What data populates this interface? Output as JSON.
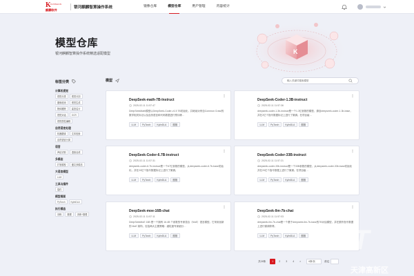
{
  "brand": {
    "logo_letter": "K",
    "logo_en": "KUNSHAN",
    "logo_cn": "麒麟软件",
    "app_title": "银河麒麟智算操作系统"
  },
  "nav": {
    "items": [
      {
        "label": "镜像仓库",
        "active": false
      },
      {
        "label": "模型仓库",
        "active": true
      },
      {
        "label": "用户管理",
        "active": false
      },
      {
        "label": "内容统计",
        "active": false
      }
    ]
  },
  "hero": {
    "title": "模型仓库",
    "subtitle": "银河麒麟智算操作系统精选适配模型"
  },
  "sidebar": {
    "header": "标签分类",
    "groups": [
      {
        "title": "计算机视觉",
        "tags": [
          "视觉分类",
          "视觉分割",
          "图像检测",
          "视觉生成",
          "物体跟踪",
          "姿态估计",
          "视觉对话",
          "OCR",
          "视觉属性编辑"
        ]
      },
      {
        "title": "自然语言处理",
        "tags": [
          "机器翻译",
          "文本检索",
          "自然语言分类"
        ]
      },
      {
        "title": "语音",
        "tags": [
          "声纹识别",
          "语音合成"
        ]
      },
      {
        "title": "多模态",
        "tags": [
          "扩散模型",
          "图文多模态"
        ]
      },
      {
        "title": "大语言模型",
        "tags": [
          "LLM"
        ]
      },
      {
        "title": "工具与插件",
        "tags": [
          "插件"
        ]
      },
      {
        "title": "模型框架",
        "tags": [
          "PyTorch",
          "KylinDLA"
        ]
      },
      {
        "title": "执行模态",
        "tags": [
          "训练",
          "推理",
          "训练+推理"
        ]
      }
    ]
  },
  "main": {
    "title": "模型",
    "search_placeholder": "输入关键词搜索模型",
    "cards": [
      {
        "title": "DeepSeek-math-7B-Instruct",
        "date": "2025-02-11 11:57:47",
        "desc": "DeepSeekMath模型以DeepSeek-Coder-v1.5 7B初始化，并继续对来自Common Crawl的数学相关标记以及自然语言和代码数据进行预训练…",
        "tags": [
          "LLM",
          "PyTorch",
          "KylinDLA",
          "图推"
        ]
      },
      {
        "title": "DeepSeek-Coder-1.3B-instruct",
        "date": "2025-02-11 11:57:36",
        "desc": "deepseek-coder-1.3b-instruct是一个1.3亿参数的模型，源自deepseek-coder-1.3b-base，并在2亿个指令数据标记上进行了微调。在项目级…",
        "tags": [
          "LLM",
          "PyTorch",
          "KylinDLA",
          "图推"
        ]
      },
      {
        "title": "DeepSeek-Coder-6.7B-instruct",
        "date": "2025-02-11 11:57:31",
        "desc": "deepseek-coder-6.7b-instruct是一个67亿参数的模型，从deepseek-coder-6.7b-base初始化，并在20亿个指令数据标记上进行了微调。",
        "tags": [
          "LLM",
          "PyTorch",
          "KylinDLA",
          "图推"
        ]
      },
      {
        "title": "DeepSeek-Coder-33B-instruct",
        "date": "2025-02-11 11:57:21",
        "desc": "deepseek-coder-33b-instruct是一个33B参数的模型，从deepseek-coder-33b-base初始化并在20亿个指令数据上进行了微调。在项目级…",
        "tags": [
          "LLM",
          "PyTorch",
          "KylinDLA",
          "图推"
        ]
      },
      {
        "title": "DeepSeek-moe-16B-chat",
        "date": "2025-02-11 11:57:11",
        "desc": "DeepSeekMoE 16B 是一个拥有 16.4B 个参数的专家混合（MoE）语言模型。它采用创新的 MoE 架构，包括两大主要策略：细粒度专家细分…",
        "tags": [
          "LLM",
          "PyTorch",
          "KylinDLA",
          "图推"
        ]
      },
      {
        "title": "DeepSeek-llm-7b-chat",
        "date": "2025-02-11 11:57:03",
        "desc": "deepseek-llm-7b-chat是一个基于deepseek-llm-7b-base的7B对话模型，并在额外指令数据上进行微调获得。",
        "tags": [
          "LLM",
          "PyTorch",
          "KylinDLA",
          "图推"
        ]
      }
    ]
  },
  "pager": {
    "total": "共28条",
    "pages": [
      "1",
      "2",
      "3",
      "4"
    ],
    "current": "1",
    "next": ">",
    "size": "6条/页",
    "goto": "前往"
  },
  "watermark": {
    "text": "HT",
    "cn": "天津高新区"
  }
}
